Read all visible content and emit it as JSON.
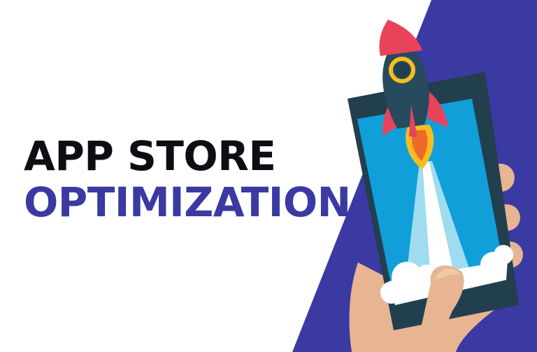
{
  "headline": {
    "line_1": "APP STORE",
    "line_2": "OPTIMIZATION"
  },
  "colors": {
    "background": "#ffffff",
    "accent_panel": "#3b39a2",
    "headline_dark": "#0d0d14",
    "headline_accent": "#3b39a2",
    "phone_body": "#223f4d",
    "phone_screen": "#109fd9",
    "rocket_body": "#274a5e",
    "rocket_fins": "#e8435a",
    "rocket_window_ring": "#f7bd1f",
    "hand_skin": "#e7b592"
  },
  "illustration": {
    "subject": "hand-holding-phone-with-rocket",
    "icons": [
      "rocket-icon",
      "smartphone-icon",
      "hand-icon",
      "cloud-icon",
      "flame-icon"
    ]
  }
}
